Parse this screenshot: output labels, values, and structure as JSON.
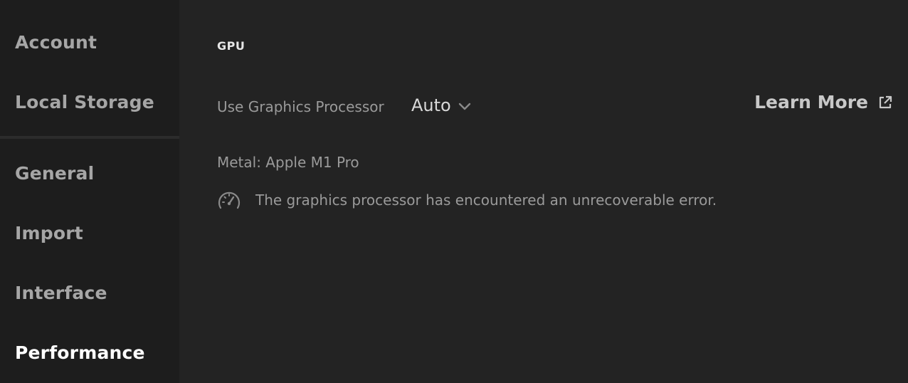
{
  "sidebar": {
    "items": [
      {
        "label": "Account",
        "active": false
      },
      {
        "label": "Local Storage",
        "active": false
      },
      {
        "label": "General",
        "active": false
      },
      {
        "label": "Import",
        "active": false
      },
      {
        "label": "Interface",
        "active": false
      },
      {
        "label": "Performance",
        "active": true
      }
    ]
  },
  "main": {
    "section_title": "GPU",
    "gpu_setting": {
      "label": "Use Graphics Processor",
      "value": "Auto"
    },
    "learn_more": {
      "label": "Learn More",
      "icon": "external-link-icon"
    },
    "gpu_name": "Metal: Apple M1 Pro",
    "status": {
      "icon": "gauge-icon",
      "text": "The graphics processor has encountered an unrecoverable error."
    }
  },
  "colors": {
    "background": "#232323",
    "sidebar_background": "#1d1d1d",
    "active_text": "#ffffff",
    "muted_text": "#9a9a9a"
  }
}
